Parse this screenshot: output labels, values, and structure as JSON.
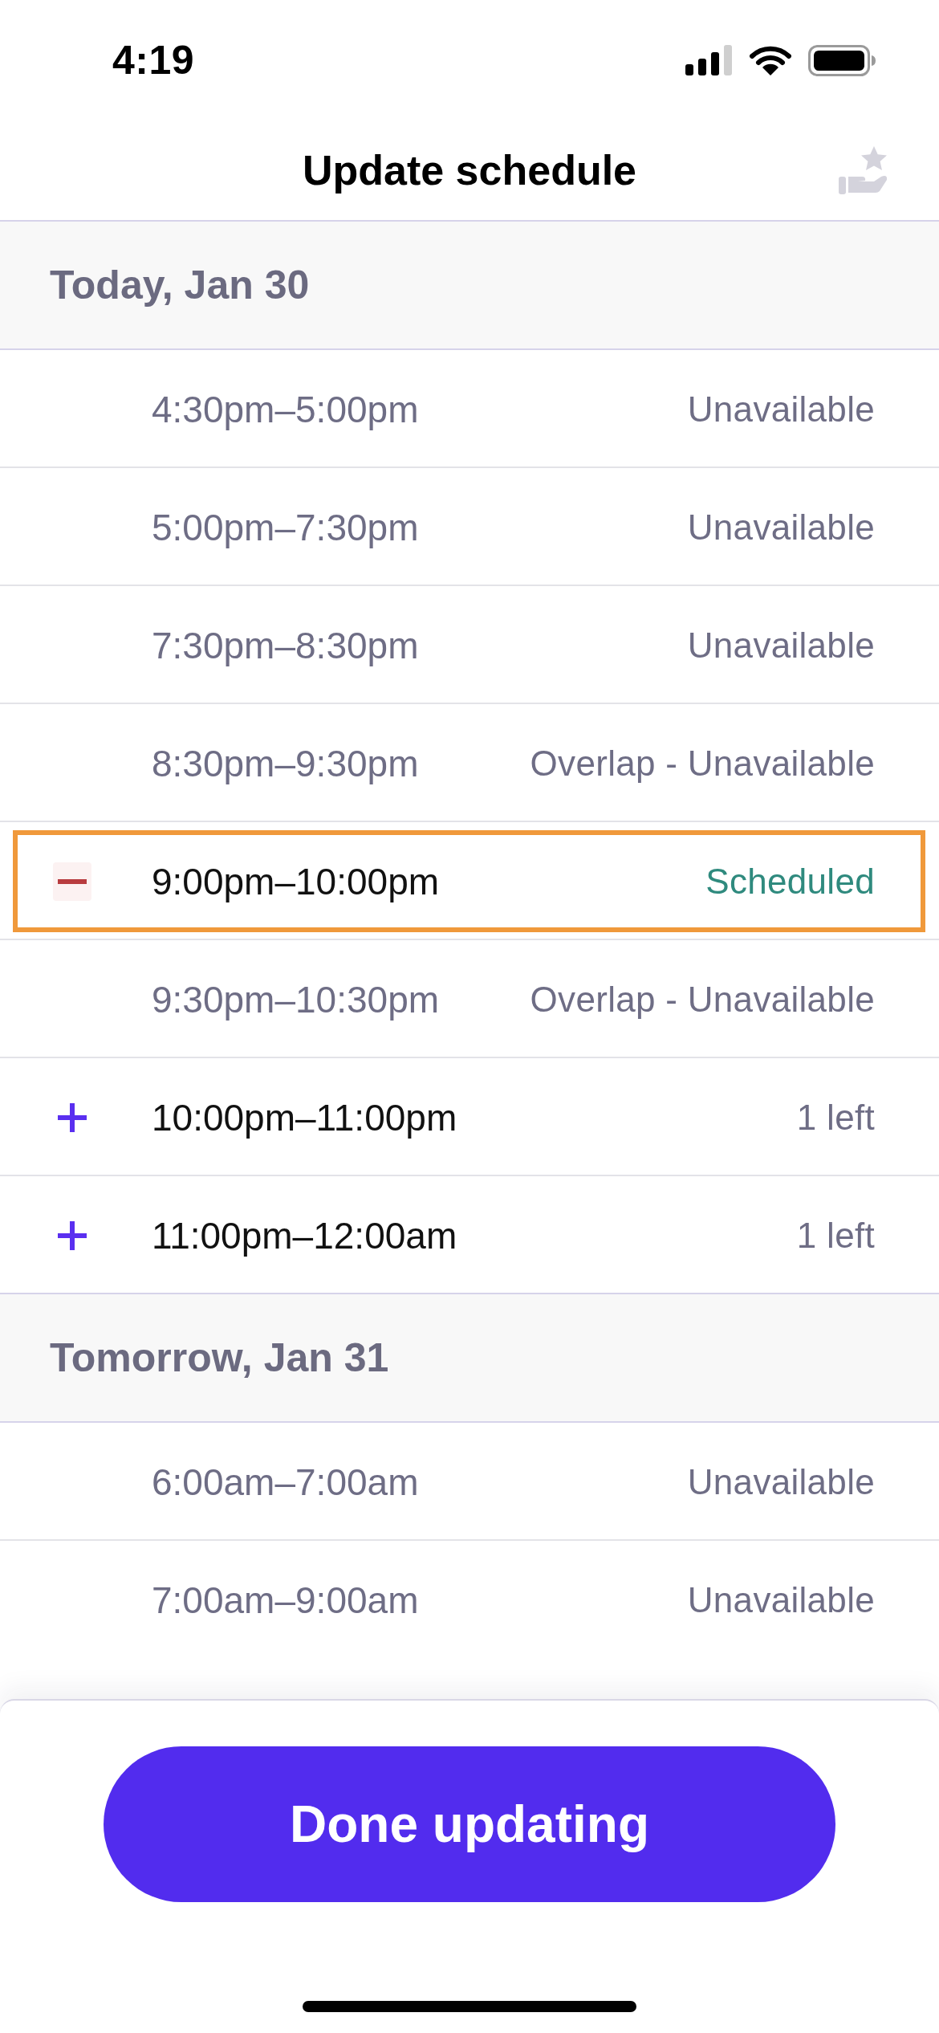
{
  "status_bar": {
    "time": "4:19"
  },
  "header": {
    "title": "Update schedule"
  },
  "sections": [
    {
      "title": "Today, Jan 30",
      "slots": [
        {
          "kind": "unavailable",
          "time": "4:30pm–5:00pm",
          "status": "Unavailable",
          "selected": false
        },
        {
          "kind": "unavailable",
          "time": "5:00pm–7:30pm",
          "status": "Unavailable",
          "selected": false
        },
        {
          "kind": "unavailable",
          "time": "7:30pm–8:30pm",
          "status": "Unavailable",
          "selected": false
        },
        {
          "kind": "unavailable",
          "time": "8:30pm–9:30pm",
          "status": "Overlap - Unavailable",
          "selected": false
        },
        {
          "kind": "scheduled",
          "time": "9:00pm–10:00pm",
          "status": "Scheduled",
          "selected": true
        },
        {
          "kind": "unavailable",
          "time": "9:30pm–10:30pm",
          "status": "Overlap - Unavailable",
          "selected": false
        },
        {
          "kind": "available",
          "time": "10:00pm–11:00pm",
          "status": "1 left",
          "selected": false
        },
        {
          "kind": "available",
          "time": "11:00pm–12:00am",
          "status": "1 left",
          "selected": false
        }
      ]
    },
    {
      "title": "Tomorrow, Jan 31",
      "slots": [
        {
          "kind": "unavailable",
          "time": "6:00am–7:00am",
          "status": "Unavailable",
          "selected": false
        },
        {
          "kind": "unavailable",
          "time": "7:00am–9:00am",
          "status": "Unavailable",
          "selected": false
        }
      ]
    }
  ],
  "done_button": {
    "label": "Done updating"
  }
}
